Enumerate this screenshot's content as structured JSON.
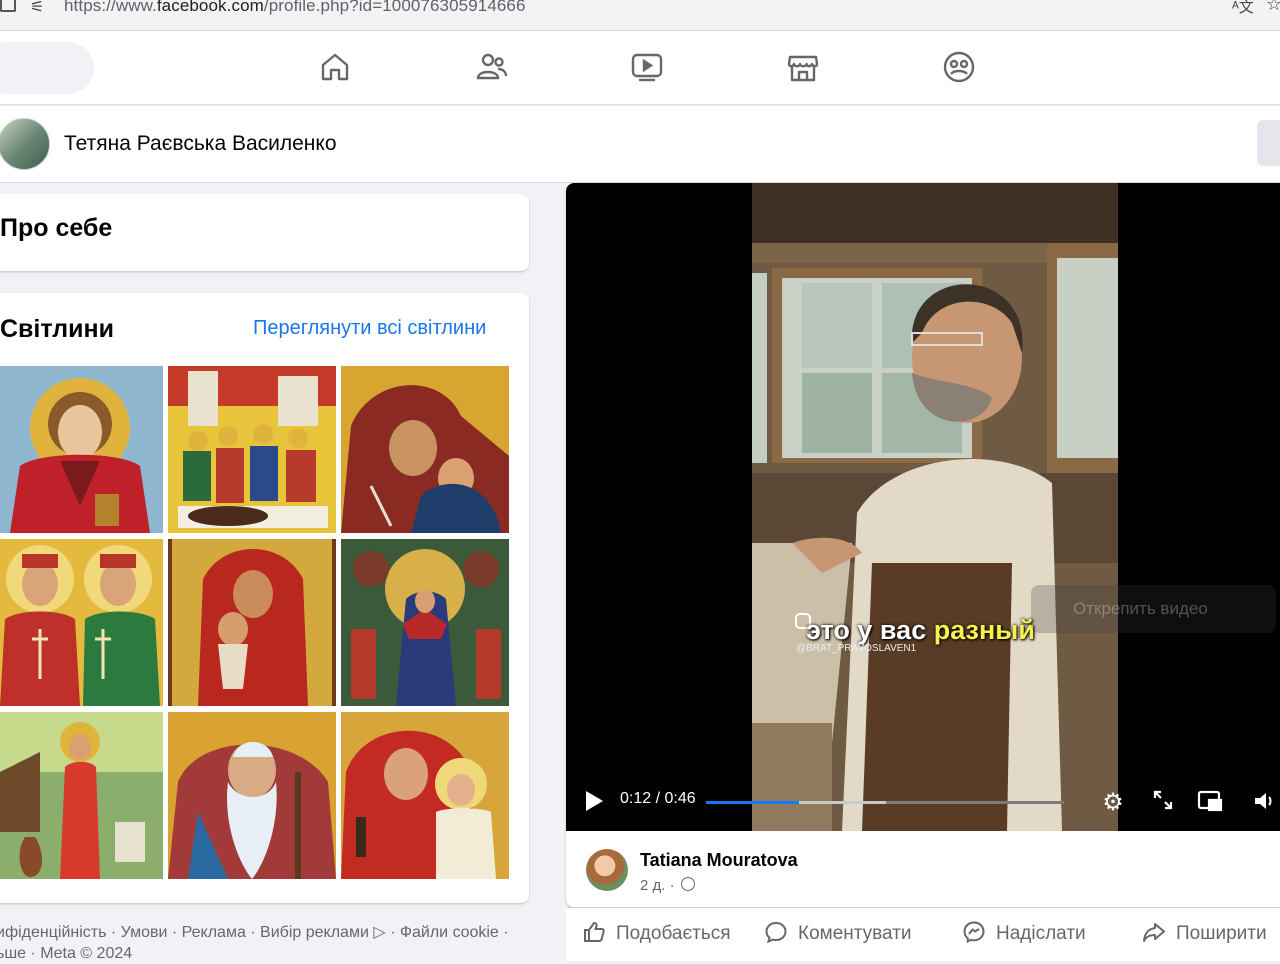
{
  "browser": {
    "url_prefix": "https://www.",
    "url_domain": "facebook.com",
    "url_path": "/profile.php?id=100076305914666"
  },
  "nav": {
    "icons": [
      "home-icon",
      "friends-icon",
      "video-icon",
      "marketplace-icon",
      "gaming-icon"
    ]
  },
  "profile": {
    "name": "Тетяна Раєвська Василенко"
  },
  "about": {
    "title": "Про себе"
  },
  "photos": {
    "title": "Світлини",
    "see_all": "Переглянути всі світлини"
  },
  "footer": {
    "line1": "ифіденційність · Умови · Реклама · Вибір реклами ▷ · Файли cookie ·",
    "line2": "ьше · Meta © 2024"
  },
  "video": {
    "subtitle_plain": "это у вас ",
    "subtitle_highlight": "разный",
    "watermark": "@BRAT_PRAVOSLAVEN1",
    "unpin": "Открепить видео",
    "time": "0:12 / 0:46",
    "progress": 0.26
  },
  "post": {
    "author": "Tatiana Mouratova",
    "time": "2 д."
  },
  "actions": {
    "like": "Подобається",
    "comment": "Коментувати",
    "send": "Надіслати",
    "share": "Поширити"
  },
  "colors": {
    "accent": "#1877f2",
    "subtitle_highlight": "#f6f34a"
  }
}
